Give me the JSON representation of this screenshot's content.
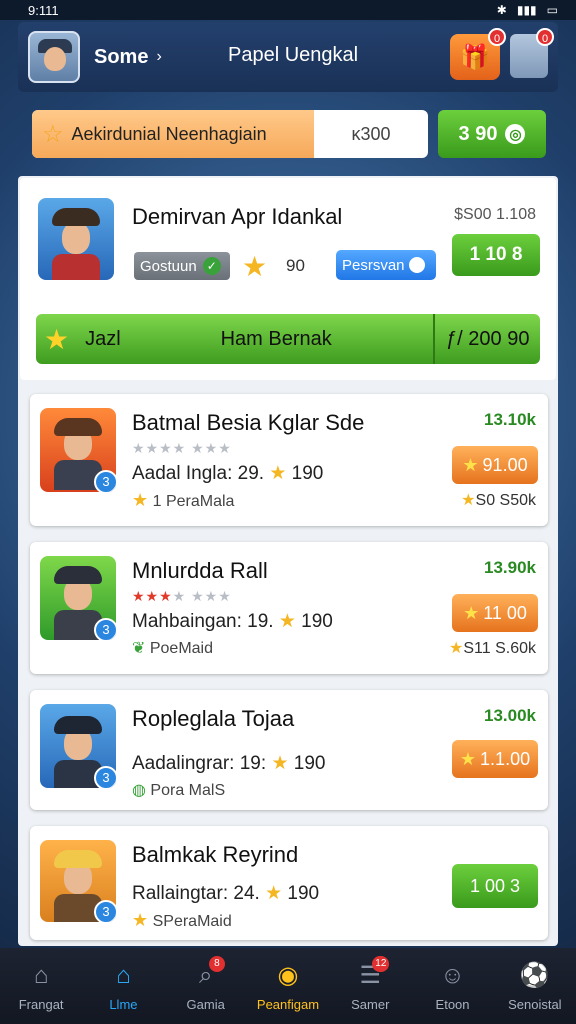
{
  "status": {
    "time": "9:111"
  },
  "header": {
    "user_name": "Some",
    "title": "Papel Uengkal",
    "gift_badge": "0",
    "profile_badge": "0"
  },
  "search": {
    "label": "Aekirdunial Neenhagiain",
    "value": "ĸ300",
    "coins": "3 90"
  },
  "featured": {
    "title": "Demirvan Apr Idankal",
    "price": "$S00 1.108",
    "tag_grey": "Gostuun",
    "rating": "90",
    "tag_blue": "Pesrsvan",
    "button": "1 10 8",
    "bar_label_left": "Jazl",
    "bar_label_mid": "Ham Bernak",
    "bar_value": "ƒ/ 200 90"
  },
  "items": [
    {
      "title": "Batmal Besia Kglar Sde",
      "stat_label": "Aadal Ingla: 29.",
      "stat_value": "190",
      "sub": "1 PeraMala",
      "top_value": "13.10k",
      "button": "91.00",
      "bottom": "S0 S50k",
      "level": "3"
    },
    {
      "title": "Mnlurdda Rall",
      "stat_label": "Mahbaingan: 19.",
      "stat_value": "190",
      "sub": "PoeMaid",
      "top_value": "13.90k",
      "button": "11 00",
      "bottom": "S11 S.60k",
      "level": "3"
    },
    {
      "title": "Ropleglala Tojaa",
      "stat_label": "Aadalingrar: 19:",
      "stat_value": "190",
      "sub": "Pora MalS",
      "top_value": "13.00k",
      "button": "1.1.00",
      "level": "3"
    },
    {
      "title": "Balmkak Reyrind",
      "stat_label": "Rallaingtar: 24.",
      "stat_value": "190",
      "sub": "SPeraMaid",
      "button": "1 00 3",
      "level": "3"
    }
  ],
  "nav": [
    {
      "label": "Frangat",
      "icon": "home-icon"
    },
    {
      "label": "Llme",
      "icon": "house-active-icon"
    },
    {
      "label": "Gamia",
      "icon": "search-icon",
      "badge": "8"
    },
    {
      "label": "Peanfigam",
      "icon": "emblem-icon"
    },
    {
      "label": "Samer",
      "icon": "list-icon",
      "badge": "12"
    },
    {
      "label": "Etoon",
      "icon": "person-icon"
    },
    {
      "label": "Senoistal",
      "icon": "ball-icon"
    }
  ],
  "colors": {
    "accent_green": "#3a9a1c",
    "accent_orange": "#e6731e",
    "accent_blue": "#2177e6",
    "nav_active": "#2aa7f5",
    "nav_highlight": "#ffc21a"
  }
}
